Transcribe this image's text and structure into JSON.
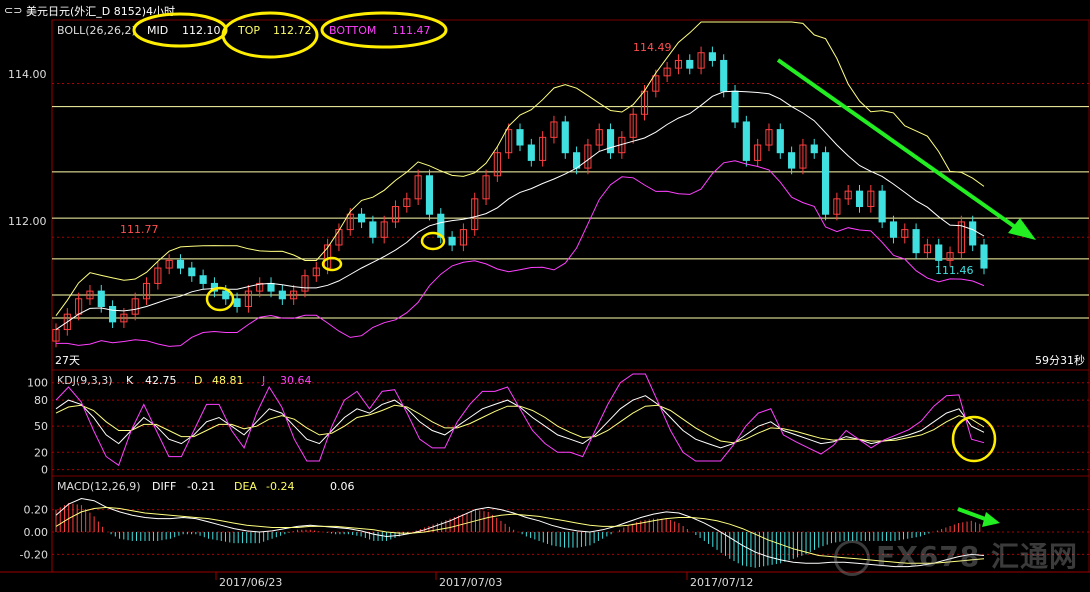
{
  "window": {
    "title": "美元日元(外汇_D 8152)4小时",
    "timer": "59分31秒",
    "period_label": "27天"
  },
  "indicators": {
    "boll": {
      "label": "BOLL(26,26,2)",
      "mid_label": "MID",
      "mid": "112.10",
      "top_label": "TOP",
      "top": "112.72",
      "bottom_label": "BOTTOM",
      "bottom": "111.47"
    },
    "kdj": {
      "label": "KDJ(9,3,3)",
      "k_label": "K",
      "k": "42.75",
      "d_label": "D",
      "d": "48.81",
      "j_label": "J",
      "j": "30.64"
    },
    "macd": {
      "label": "MACD(12,26,9)",
      "diff_label": "DIFF",
      "diff": "-0.21",
      "dea_label": "DEA",
      "dea": "-0.24",
      "macd": "0.06"
    }
  },
  "annotations": {
    "high": "114.49",
    "peak_left": "111.77",
    "low": "111.46"
  },
  "watermark": "FX678 汇通网",
  "colors": {
    "background": "#000000",
    "up": "#ff4040",
    "down": "#40e0e0",
    "boll_mid": "#ffffff",
    "boll_top": "#ffff80",
    "boll_bottom": "#ff40ff",
    "level_line": "#ffff99",
    "arrow": "#22ee22",
    "circle": "#ffee00"
  },
  "chart_data": [
    {
      "type": "line",
      "title": "美元日元(外汇_D 8152)4小时",
      "xlabel": "",
      "ylabel": "",
      "x_ticks": [
        "2017/06/23",
        "2017/07/03",
        "2017/07/12"
      ],
      "y_ticks": [
        "114.00",
        "112.00"
      ],
      "ylim": [
        110.3,
        114.8
      ],
      "horizontal_levels": [
        113.7,
        112.85,
        112.25,
        111.72,
        111.25,
        110.95
      ],
      "series_close": [
        110.8,
        111.0,
        111.2,
        111.3,
        111.1,
        110.9,
        111.0,
        111.2,
        111.4,
        111.6,
        111.7,
        111.6,
        111.5,
        111.4,
        111.3,
        111.2,
        111.1,
        111.3,
        111.4,
        111.3,
        111.2,
        111.3,
        111.5,
        111.6,
        111.9,
        112.1,
        112.3,
        112.2,
        112.0,
        112.2,
        112.4,
        112.5,
        112.8,
        112.3,
        112.0,
        111.9,
        112.1,
        112.5,
        112.8,
        113.1,
        113.4,
        113.2,
        113.0,
        113.3,
        113.5,
        113.1,
        112.9,
        113.2,
        113.4,
        113.1,
        113.3,
        113.6,
        113.9,
        114.1,
        114.2,
        114.3,
        114.2,
        114.4,
        114.3,
        113.9,
        113.5,
        113.0,
        113.2,
        113.4,
        113.1,
        112.9,
        113.2,
        113.1,
        112.3,
        112.5,
        112.6,
        112.4,
        112.6,
        112.2,
        112.0,
        112.1,
        111.8,
        111.9,
        111.7,
        111.8,
        112.2,
        111.9,
        111.6
      ]
    },
    {
      "type": "line",
      "title": "KDJ(9,3,3)",
      "y_ticks": [
        "100",
        "80",
        "50",
        "20",
        "0"
      ],
      "ylim": [
        -5,
        110
      ],
      "series": [
        {
          "name": "K",
          "values": [
            70,
            80,
            75,
            60,
            40,
            30,
            45,
            60,
            50,
            35,
            30,
            40,
            55,
            60,
            50,
            40,
            55,
            70,
            65,
            50,
            35,
            30,
            45,
            60,
            70,
            65,
            75,
            80,
            70,
            55,
            45,
            40,
            50,
            60,
            70,
            75,
            80,
            72,
            60,
            50,
            40,
            35,
            30,
            40,
            55,
            70,
            80,
            85,
            75,
            60,
            45,
            35,
            30,
            25,
            30,
            40,
            50,
            55,
            45,
            40,
            35,
            30,
            32,
            38,
            35,
            30,
            33,
            36,
            40,
            45,
            55,
            65,
            70,
            50,
            43
          ]
        },
        {
          "name": "D",
          "values": [
            65,
            72,
            74,
            68,
            55,
            45,
            45,
            52,
            52,
            45,
            38,
            38,
            45,
            52,
            52,
            47,
            50,
            58,
            62,
            58,
            48,
            40,
            42,
            50,
            60,
            63,
            68,
            74,
            72,
            64,
            55,
            48,
            48,
            53,
            60,
            67,
            73,
            73,
            68,
            60,
            50,
            43,
            37,
            38,
            45,
            55,
            65,
            73,
            74,
            68,
            58,
            48,
            40,
            33,
            31,
            35,
            42,
            48,
            47,
            44,
            40,
            36,
            34,
            35,
            35,
            33,
            33,
            34,
            37,
            40,
            46,
            55,
            62,
            58,
            49
          ]
        },
        {
          "name": "J",
          "values": [
            80,
            95,
            78,
            45,
            15,
            5,
            45,
            75,
            45,
            15,
            15,
            45,
            75,
            75,
            45,
            25,
            65,
            95,
            72,
            35,
            10,
            10,
            50,
            80,
            90,
            70,
            90,
            92,
            65,
            35,
            25,
            25,
            55,
            75,
            90,
            90,
            95,
            70,
            45,
            30,
            20,
            20,
            15,
            45,
            75,
            100,
            110,
            110,
            78,
            45,
            20,
            10,
            10,
            10,
            28,
            50,
            65,
            70,
            40,
            32,
            25,
            18,
            28,
            45,
            35,
            25,
            34,
            40,
            46,
            56,
            73,
            85,
            86,
            35,
            31
          ]
        }
      ]
    },
    {
      "type": "bar",
      "title": "MACD(12,26,9)",
      "y_ticks": [
        "0.20",
        "0.00",
        "-0.20"
      ],
      "ylim": [
        -0.34,
        0.34
      ],
      "series": [
        {
          "name": "DIFF",
          "values": [
            0.15,
            0.25,
            0.3,
            0.28,
            0.22,
            0.18,
            0.15,
            0.13,
            0.12,
            0.12,
            0.13,
            0.12,
            0.09,
            0.06,
            0.03,
            0.01,
            0.0,
            0.01,
            0.03,
            0.05,
            0.06,
            0.05,
            0.04,
            0.03,
            0.01,
            -0.02,
            -0.04,
            -0.03,
            -0.01,
            0.02,
            0.06,
            0.1,
            0.15,
            0.2,
            0.22,
            0.2,
            0.17,
            0.13,
            0.1,
            0.06,
            0.03,
            0.01,
            0.0,
            0.02,
            0.05,
            0.09,
            0.13,
            0.16,
            0.18,
            0.17,
            0.13,
            0.08,
            0.02,
            -0.05,
            -0.12,
            -0.18,
            -0.22,
            -0.25,
            -0.27,
            -0.28,
            -0.28,
            -0.27,
            -0.27,
            -0.28,
            -0.29,
            -0.3,
            -0.31,
            -0.31,
            -0.3,
            -0.28,
            -0.25,
            -0.22,
            -0.2,
            -0.21
          ]
        },
        {
          "name": "DEA",
          "values": [
            0.05,
            0.12,
            0.18,
            0.21,
            0.22,
            0.21,
            0.19,
            0.17,
            0.16,
            0.15,
            0.14,
            0.13,
            0.12,
            0.1,
            0.08,
            0.06,
            0.05,
            0.04,
            0.04,
            0.04,
            0.05,
            0.05,
            0.05,
            0.04,
            0.03,
            0.02,
            0.0,
            -0.01,
            -0.01,
            0.0,
            0.02,
            0.04,
            0.07,
            0.1,
            0.13,
            0.15,
            0.16,
            0.15,
            0.14,
            0.12,
            0.1,
            0.08,
            0.06,
            0.05,
            0.05,
            0.06,
            0.08,
            0.1,
            0.12,
            0.13,
            0.13,
            0.12,
            0.1,
            0.07,
            0.03,
            -0.02,
            -0.07,
            -0.11,
            -0.15,
            -0.18,
            -0.21,
            -0.22,
            -0.23,
            -0.24,
            -0.25,
            -0.26,
            -0.27,
            -0.28,
            -0.28,
            -0.28,
            -0.27,
            -0.26,
            -0.25,
            -0.24
          ]
        }
      ]
    }
  ]
}
